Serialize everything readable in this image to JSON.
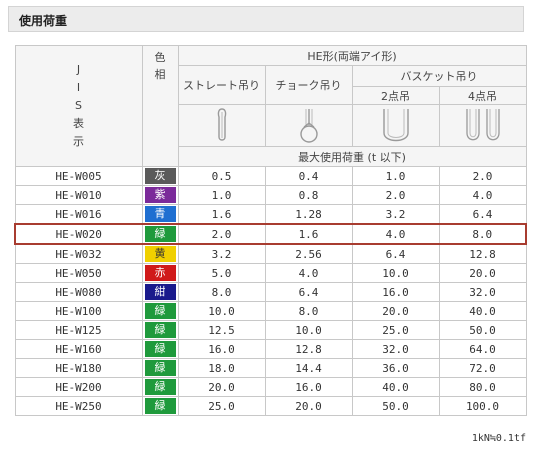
{
  "title": "使用荷重",
  "header": {
    "jis": [
      "J",
      "I",
      "S",
      "表",
      "示"
    ],
    "color": [
      "色",
      "相"
    ],
    "type_label": "HE形(両端アイ形)",
    "straight": "ストレート吊り",
    "choke": "チョーク吊り",
    "basket": "バスケット吊り",
    "two_point": "2点吊",
    "four_point": "4点吊",
    "max_load": "最大使用荷重 (t 以下)"
  },
  "rows": [
    {
      "model": "HE-W005",
      "color_label": "灰",
      "color": "#5a5a5a",
      "straight": "0.5",
      "choke": "0.4",
      "b2": "1.0",
      "b4": "2.0"
    },
    {
      "model": "HE-W010",
      "color_label": "紫",
      "color": "#7b2a9a",
      "straight": "1.0",
      "choke": "0.8",
      "b2": "2.0",
      "b4": "4.0"
    },
    {
      "model": "HE-W016",
      "color_label": "青",
      "color": "#1f6fd1",
      "straight": "1.6",
      "choke": "1.28",
      "b2": "3.2",
      "b4": "6.4"
    },
    {
      "model": "HE-W020",
      "color_label": "緑",
      "color": "#1f9a3c",
      "straight": "2.0",
      "choke": "1.6",
      "b2": "4.0",
      "b4": "8.0",
      "highlight": true
    },
    {
      "model": "HE-W032",
      "color_label": "黄",
      "color": "#f0d000",
      "straight": "3.2",
      "choke": "2.56",
      "b2": "6.4",
      "b4": "12.8",
      "text_color": "#333333"
    },
    {
      "model": "HE-W050",
      "color_label": "赤",
      "color": "#d01a1a",
      "straight": "5.0",
      "choke": "4.0",
      "b2": "10.0",
      "b4": "20.0"
    },
    {
      "model": "HE-W080",
      "color_label": "紺",
      "color": "#1a1a8c",
      "straight": "8.0",
      "choke": "6.4",
      "b2": "16.0",
      "b4": "32.0"
    },
    {
      "model": "HE-W100",
      "color_label": "緑",
      "color": "#1f9a3c",
      "straight": "10.0",
      "choke": "8.0",
      "b2": "20.0",
      "b4": "40.0"
    },
    {
      "model": "HE-W125",
      "color_label": "緑",
      "color": "#1f9a3c",
      "straight": "12.5",
      "choke": "10.0",
      "b2": "25.0",
      "b4": "50.0"
    },
    {
      "model": "HE-W160",
      "color_label": "緑",
      "color": "#1f9a3c",
      "straight": "16.0",
      "choke": "12.8",
      "b2": "32.0",
      "b4": "64.0"
    },
    {
      "model": "HE-W180",
      "color_label": "緑",
      "color": "#1f9a3c",
      "straight": "18.0",
      "choke": "14.4",
      "b2": "36.0",
      "b4": "72.0"
    },
    {
      "model": "HE-W200",
      "color_label": "緑",
      "color": "#1f9a3c",
      "straight": "20.0",
      "choke": "16.0",
      "b2": "40.0",
      "b4": "80.0"
    },
    {
      "model": "HE-W250",
      "color_label": "緑",
      "color": "#1f9a3c",
      "straight": "25.0",
      "choke": "20.0",
      "b2": "50.0",
      "b4": "100.0"
    }
  ],
  "footnote": "1kN≒0.1tf"
}
